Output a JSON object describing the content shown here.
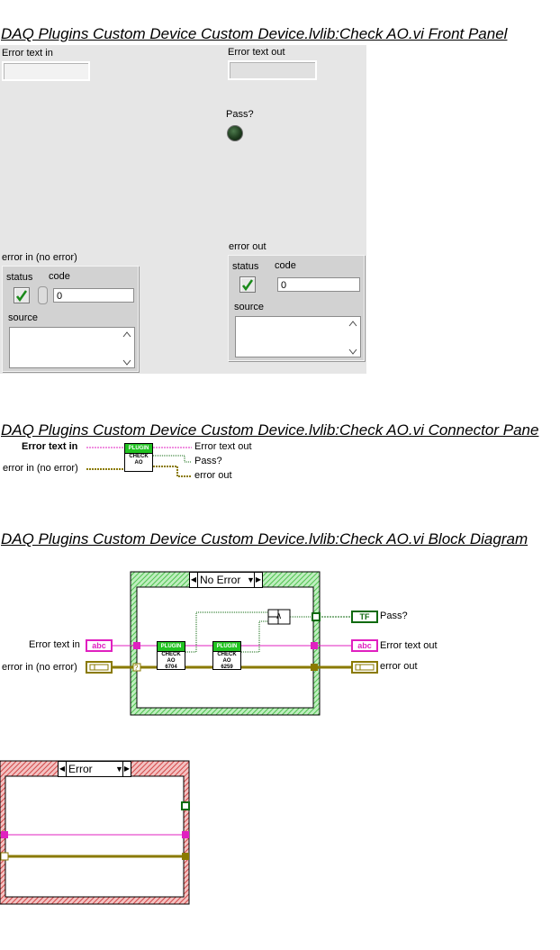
{
  "headings": {
    "front_panel": "DAQ Plugins Custom Device Custom Device.lvlib:Check AO.vi Front Panel",
    "connector_pane": "DAQ Plugins Custom Device Custom Device.lvlib:Check AO.vi Connector Pane",
    "block_diagram": "DAQ Plugins Custom Device Custom Device.lvlib:Check AO.vi Block Diagram"
  },
  "front_panel": {
    "error_text_in_label": "Error text in",
    "error_text_out_label": "Error text out",
    "pass_label": "Pass?",
    "error_in": {
      "label": "error in (no error)",
      "status_label": "status",
      "code_label": "code",
      "code_value": "0",
      "source_label": "source"
    },
    "error_out": {
      "label": "error out",
      "status_label": "status",
      "code_label": "code",
      "code_value": "0",
      "source_label": "source"
    }
  },
  "connector_pane": {
    "input_error_text": "Error text in",
    "input_error_in": "error in (no error)",
    "output_error_text": "Error text out",
    "output_pass": "Pass?",
    "output_error_out": "error out",
    "icon_band": "PLUGIN",
    "icon_text": "CHECK\nAO"
  },
  "block_diagram": {
    "case_no_error": "No Error",
    "case_error": "Error",
    "terminal_error_text_in": "Error text in",
    "terminal_error_in": "error in (no error)",
    "terminal_pass": "Pass?",
    "terminal_error_text_out": "Error text out",
    "terminal_error_out": "error out",
    "str_term_glyph": "abc",
    "bool_term_glyph": "TF",
    "subvi1_band": "PLUGIN",
    "subvi1_text": "CHECK AO 6704",
    "subvi2_band": "PLUGIN",
    "subvi2_text": "CHECK AO 6259",
    "and_glyph": "∧",
    "case_selector_input_glyph": "?"
  },
  "colors": {
    "string_wire": "#e020c0",
    "error_wire": "#8a7a00",
    "bool_wire": "#0f6a0f",
    "no_error_frame": "#4ec24e",
    "error_frame": "#d24646",
    "subvi_band": "#22c322"
  }
}
